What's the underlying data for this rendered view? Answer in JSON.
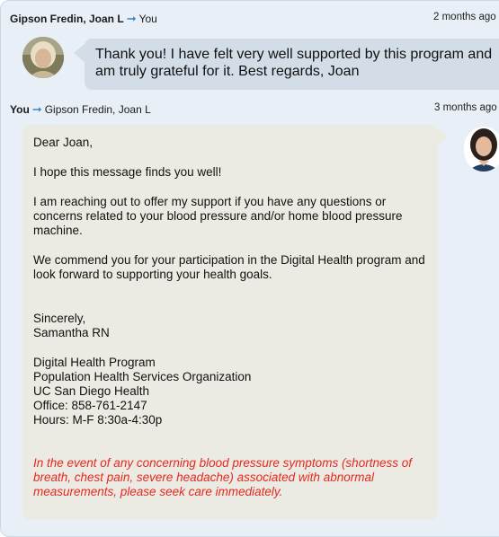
{
  "message1": {
    "sender": "Gipson Fredin, Joan L",
    "recipient": "You",
    "time": "2 months ago",
    "body": "Thank you! I have felt very well supported by this program and am truly grateful for it. Best regards, Joan"
  },
  "message2": {
    "sender": "You",
    "recipient": "Gipson Fredin, Joan L",
    "time": "3 months ago",
    "greeting": "Dear Joan,",
    "p1": "I hope this message finds you well!",
    "p2": "I am reaching out to offer my support if you have any questions or concerns related to your blood pressure and/or home blood pressure machine.",
    "p3": "We commend you for your participation in the Digital Health program and look forward to supporting your health goals.",
    "closing": "Sincerely,",
    "signer": "Samantha RN",
    "sig": [
      "Digital Health Program",
      "Population Health Services Organization",
      "UC San Diego Health",
      "Office: 858-761-2147",
      "Hours: M-F 8:30a-4:30p"
    ],
    "warning": "In the event of any concerning blood pressure symptoms (shortness of breath, chest pain, severe headache) associated with abnormal measurements, please seek care immediately."
  },
  "colors": {
    "panel": "#e8eff6",
    "incoming_bubble": "#d2dde8",
    "outgoing_bubble": "#ecebe3",
    "arrow": "#2f7fc1",
    "warning": "#e5281e"
  },
  "icons": {
    "arrow": "right-arrow-icon"
  }
}
